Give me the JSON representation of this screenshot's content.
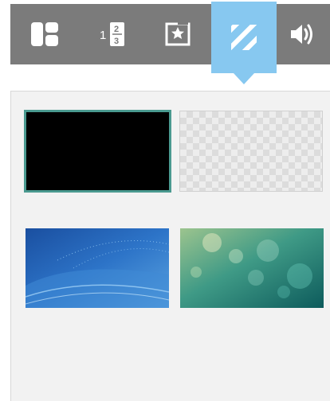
{
  "toolbar": {
    "items": [
      {
        "icon": "layout-icon",
        "active": false
      },
      {
        "icon": "slide-number-icon",
        "active": false,
        "glyphs": [
          "1",
          "2",
          "3"
        ]
      },
      {
        "icon": "frame-icon",
        "active": false
      },
      {
        "icon": "background-stripes-icon",
        "active": true
      },
      {
        "icon": "speaker-icon",
        "active": false
      }
    ],
    "strip_color": "#7b7b7b",
    "active_color": "#87c8f0"
  },
  "backgrounds": {
    "panel_color": "#f2f2f2",
    "selected_border_color": "#4a9a90",
    "swatches": [
      {
        "name": "black",
        "color": "#000000",
        "selected": true
      },
      {
        "name": "transparent",
        "color": "#ededed",
        "selected": false
      },
      {
        "name": "blue-abstract",
        "color": "#2d6fc0",
        "selected": false
      },
      {
        "name": "green-bokeh",
        "color": "#1e8d84",
        "selected": false
      }
    ]
  }
}
